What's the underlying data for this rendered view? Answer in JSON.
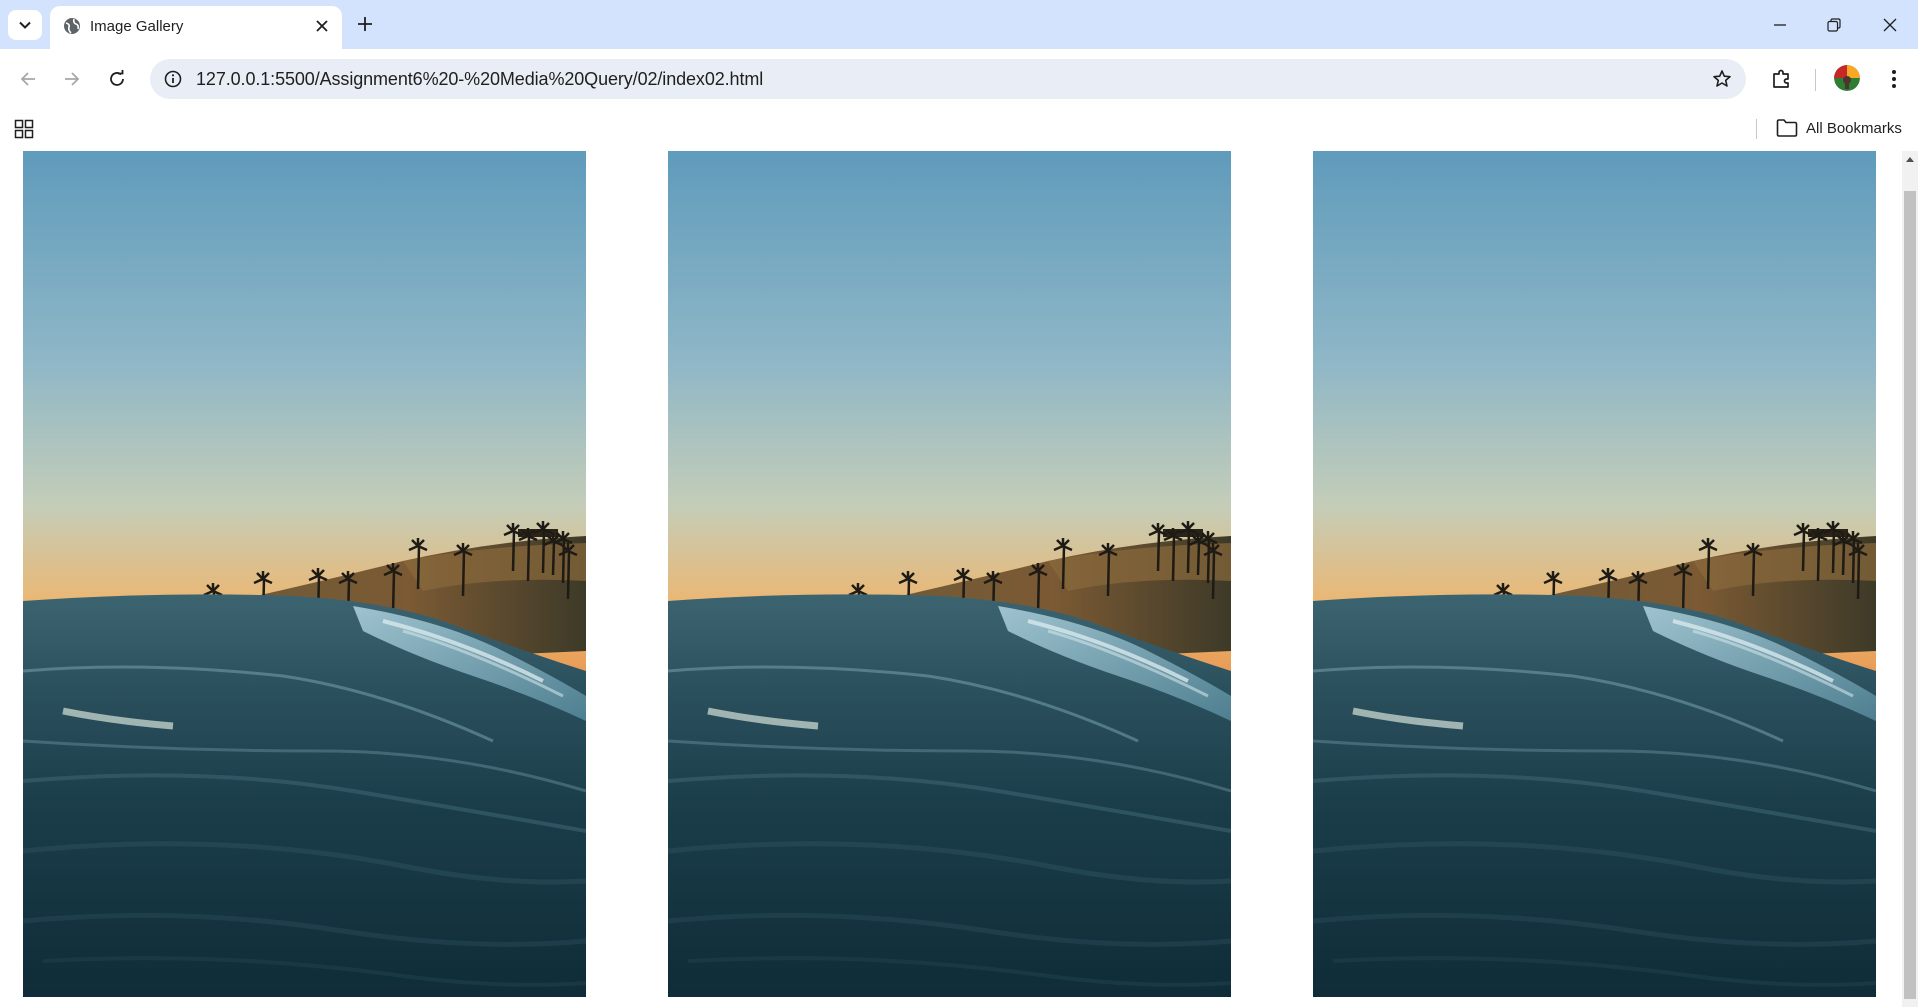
{
  "browser": {
    "tab": {
      "title": "Image Gallery",
      "favicon": "globe-icon"
    },
    "address_bar": {
      "url": "127.0.0.1:5500/Assignment6%20-%20Media%20Query/02/index02.html"
    },
    "bookmarks_bar": {
      "all_bookmarks_label": "All Bookmarks"
    },
    "icons": {
      "tab_search": "chevron-down-icon",
      "new_tab": "plus-icon",
      "minimize": "minimize-icon",
      "restore": "restore-icon",
      "close": "close-icon",
      "back": "back-arrow-icon",
      "forward": "forward-arrow-icon",
      "reload": "reload-icon",
      "site_info": "info-icon",
      "bookmark": "star-icon",
      "extensions": "puzzle-icon",
      "menu": "kebab-menu-icon",
      "apps": "apps-grid-icon",
      "folder": "folder-icon"
    }
  },
  "page": {
    "gallery": {
      "images": [
        {
          "subject": "ocean wave at sunset with palm-lined coast"
        },
        {
          "subject": "ocean wave at sunset with palm-lined coast"
        },
        {
          "subject": "ocean wave at sunset with palm-lined coast"
        }
      ]
    }
  },
  "colors": {
    "tabstrip": "#d3e3fd",
    "omnibox": "#e9eef6",
    "sky_top": "#5f9bbb",
    "sky_horizon": "#f0b46a",
    "sea_dark": "#0f2c38"
  }
}
